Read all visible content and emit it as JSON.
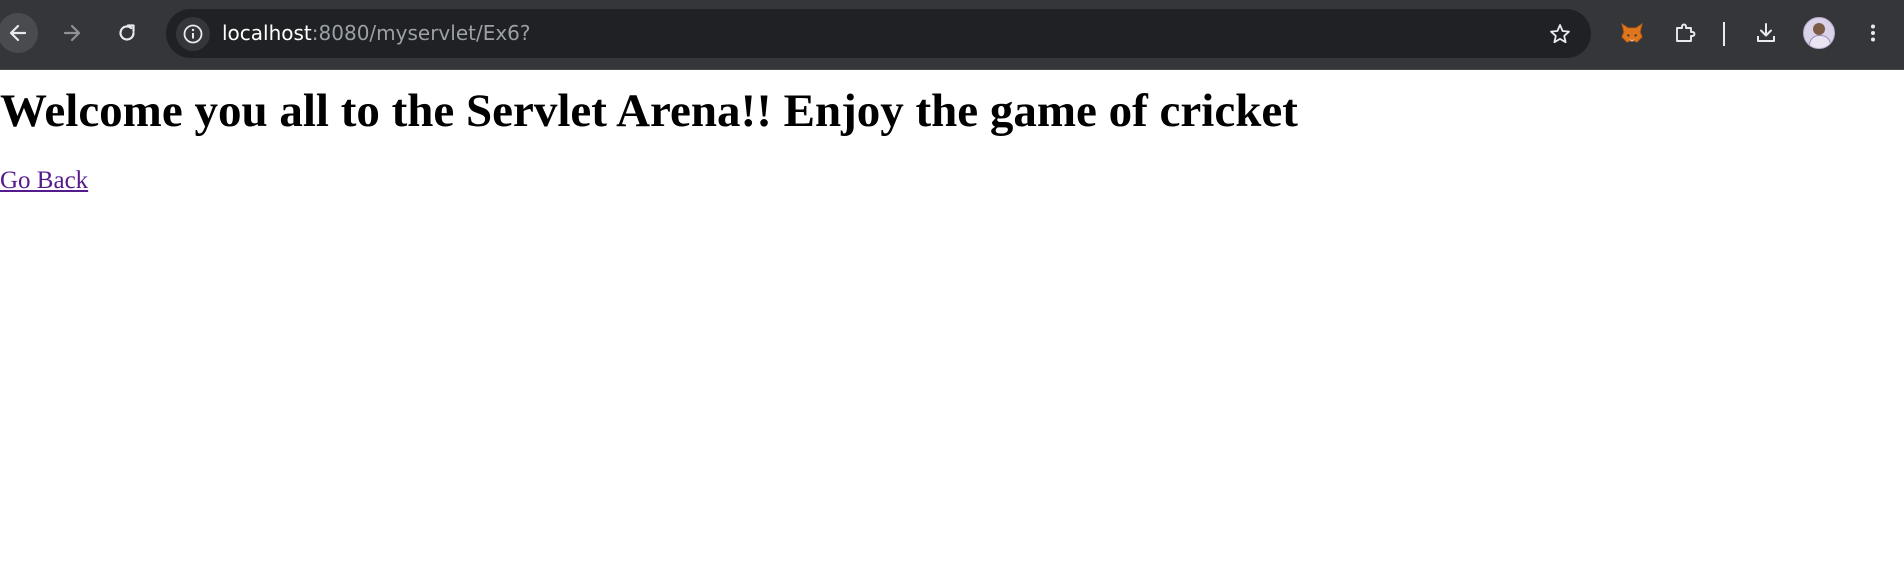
{
  "browser": {
    "url_host": "localhost",
    "url_rest": ":8080/myservlet/Ex6?",
    "icons": {
      "back": "arrow-left-icon",
      "forward": "arrow-right-icon",
      "reload": "reload-icon",
      "site_info": "info-icon",
      "bookmark": "star-icon",
      "extension_fox": "fox-extension-icon",
      "extensions": "puzzle-icon",
      "download": "download-icon",
      "profile": "avatar-icon",
      "menu": "kebab-menu-icon"
    },
    "colors": {
      "toolbar": "#35363a",
      "omnibox": "#202124",
      "host_text": "#ffffff",
      "path_text": "#9aa0a6"
    }
  },
  "page": {
    "heading": "Welcome you all to the Servlet Arena!! Enjoy the game of cricket",
    "link_label": "Go Back",
    "colors": {
      "background": "#ffffff",
      "heading": "#000000",
      "visited_link": "#551a8b"
    }
  }
}
